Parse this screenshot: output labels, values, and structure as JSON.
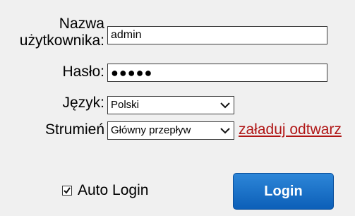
{
  "form": {
    "username_label_line1": "Nazwa",
    "username_label_line2": "użytkownika:",
    "username_value": "admin",
    "password_label": "Hasło:",
    "password_value_masked": "●●●●●",
    "language_label": "Język:",
    "language_value": "Polski",
    "stream_label": "Strumień",
    "stream_value": "Główny przepływ",
    "load_player_link": "załaduj odtwarz",
    "auto_login_label": "Auto Login",
    "auto_login_checked": true,
    "login_button": "Login"
  },
  "colors": {
    "background": "#f0f0f0",
    "link": "#b01515",
    "button": "#1a6fc8"
  }
}
